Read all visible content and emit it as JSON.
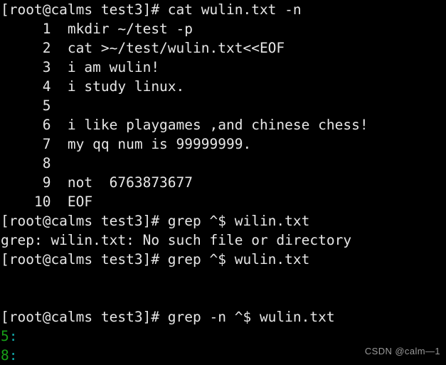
{
  "terminal": {
    "background_color": "#000000",
    "foreground_color": "#e6e6e6",
    "green_color": "#18a018",
    "cyan_color": "#12a8a8",
    "prompt": "[root@calms test3]#",
    "user": "root",
    "host": "calms",
    "cwd": "test3",
    "lines": [
      {
        "id": "line-00",
        "kind": "command",
        "text": "[root@calms test3]# cat wulin.txt -n"
      },
      {
        "id": "line-01",
        "kind": "file-line",
        "text": "     1  mkdir ~/test -p"
      },
      {
        "id": "line-02",
        "kind": "file-line",
        "text": "     2  cat >~/test/wulin.txt<<EOF"
      },
      {
        "id": "line-03",
        "kind": "file-line",
        "text": "     3  i am wulin!"
      },
      {
        "id": "line-04",
        "kind": "file-line",
        "text": "     4  i study linux."
      },
      {
        "id": "line-05",
        "kind": "file-line",
        "text": "     5"
      },
      {
        "id": "line-06",
        "kind": "file-line",
        "text": "     6  i like playgames ,and chinese chess!"
      },
      {
        "id": "line-07",
        "kind": "file-line",
        "text": "     7  my qq num is 99999999."
      },
      {
        "id": "line-08",
        "kind": "file-line",
        "text": "     8"
      },
      {
        "id": "line-09",
        "kind": "file-line",
        "text": "     9  not  6763873677"
      },
      {
        "id": "line-10",
        "kind": "file-line",
        "text": "    10  EOF"
      },
      {
        "id": "line-11",
        "kind": "command",
        "text": "[root@calms test3]# grep ^$ wilin.txt"
      },
      {
        "id": "line-12",
        "kind": "error",
        "text": "grep: wilin.txt: No such file or directory"
      },
      {
        "id": "line-13",
        "kind": "command",
        "text": "[root@calms test3]# grep ^$ wulin.txt"
      },
      {
        "id": "line-14",
        "kind": "blank",
        "text": ""
      },
      {
        "id": "line-15",
        "kind": "blank",
        "text": ""
      },
      {
        "id": "line-16",
        "kind": "command",
        "text": "[root@calms test3]# grep -n ^$ wulin.txt"
      },
      {
        "id": "line-17",
        "kind": "grep-match",
        "segments": [
          {
            "text": "5",
            "color": "green"
          },
          {
            "text": ":",
            "color": "cyan"
          }
        ]
      },
      {
        "id": "line-18",
        "kind": "grep-match",
        "segments": [
          {
            "text": "8",
            "color": "green"
          },
          {
            "text": ":",
            "color": "cyan"
          }
        ]
      }
    ]
  },
  "watermark": {
    "text": "CSDN @calm—1"
  }
}
